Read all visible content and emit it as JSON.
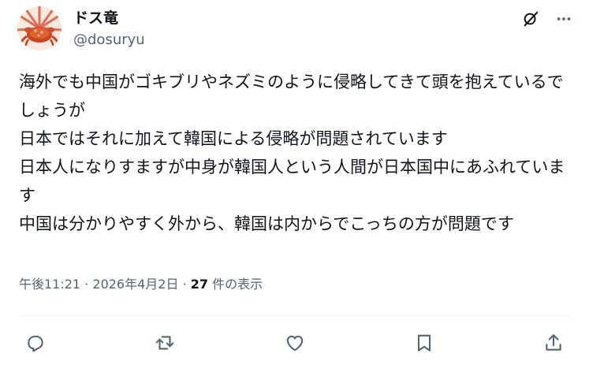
{
  "author": {
    "display_name": "ドス竜",
    "handle": "@dosuryu"
  },
  "post": {
    "lines": [
      "海外でも中国がゴキブリやネズミのように侵略してきて頭を抱えているでしょうが",
      "日本ではそれに加えて韓国による侵略が問題されています",
      "日本人になりすますが中身が韓国人という人間が日本国中にあふれています",
      "中国は分かりやすく外から、韓国は内からでこっちの方が問題です"
    ]
  },
  "meta": {
    "time": "午後11:21",
    "separator1": " · ",
    "date": "2026年4月2日",
    "separator2": " · ",
    "views_count": "27",
    "views_label": " 件の表示"
  },
  "icons": {
    "top": [
      "grok-icon",
      "more-icon"
    ],
    "actions": [
      "reply-icon",
      "repost-icon",
      "like-icon",
      "bookmark-icon",
      "share-icon"
    ]
  },
  "colors": {
    "text": "#0f1419",
    "secondary": "#536471",
    "divider": "#eff3f4"
  }
}
